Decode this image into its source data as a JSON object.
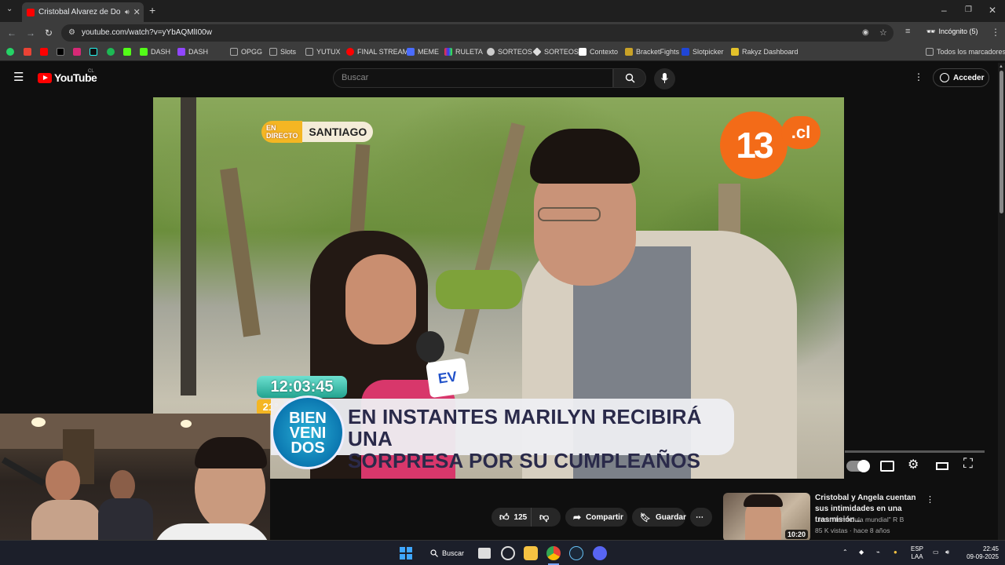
{
  "browser": {
    "tab_title": "Cristobal Alvarez de Doble",
    "url": "youtube.com/watch?v=yYbAQMlI00w",
    "profile": "Incógnito (5)",
    "bookmarks": [
      "DASH",
      "DASH",
      "OPGG",
      "Slots",
      "YUTUX",
      "FINAL STREAM",
      "MEME",
      "RULETA",
      "SORTEOS",
      "SORTEOS",
      "Contexto",
      "BracketFights",
      "Slotpicker",
      "Rakyz Dashboard"
    ],
    "all_bookmarks": "Todos los marcadores"
  },
  "youtube": {
    "logo_text": "YouTube",
    "region": "CL",
    "search_placeholder": "Buscar",
    "sign_in": "Acceder"
  },
  "video": {
    "live_label_1": "EN",
    "live_label_2": "DIRECTO",
    "location": "SANTIAGO",
    "channel_logo": "13",
    "channel_suffix": ".cl",
    "clock": "12:03:45",
    "temperature": "21°",
    "welcome_badge": [
      "BIEN",
      "VENI",
      "DOS"
    ],
    "headline_1": "EN INSTANTES MARILYN RECIBIRÁ UNA",
    "headline_2": "SORPRESA POR SU CUMPLEAÑOS",
    "mic_logo": "EV"
  },
  "actions": {
    "likes": "125",
    "share": "Compartir",
    "save": "Guardar"
  },
  "recommendation": {
    "title": "Cristobal y Angela cuentan sus intimidades en una trasmisión...",
    "channel": "Linda \"farandula mundial\" R B",
    "meta": "85 K vistas · hace 8 años",
    "duration": "10:20"
  },
  "taskbar": {
    "search": "Buscar",
    "lang_1": "ESP",
    "lang_2": "LAA",
    "time": "22:45",
    "date": "09-09-2025"
  },
  "colors": {
    "youtube_red": "#ff0000",
    "channel_orange": "#f36b18",
    "headline_navy": "#2a2a4a"
  }
}
